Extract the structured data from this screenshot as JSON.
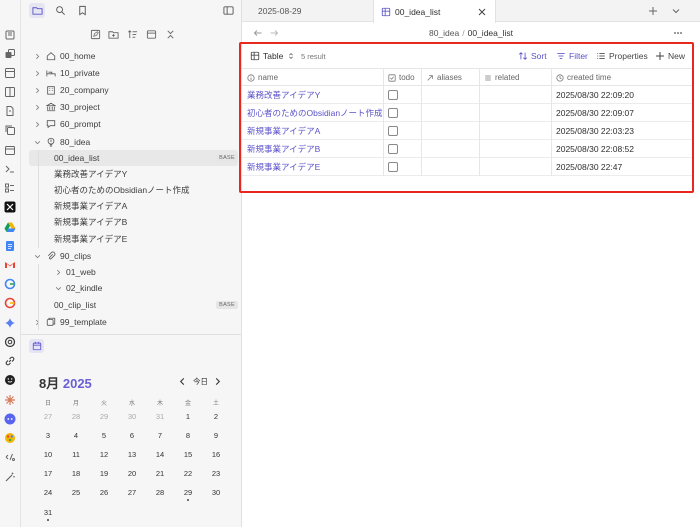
{
  "ribbon": {
    "icons": [
      "files-icon",
      "cards-icon",
      "layout-icon",
      "columns-icon",
      "pages-icon",
      "copy-icon",
      "calendar-icon",
      "terminal-icon",
      "list-icon",
      "x-brand-icon",
      "drive-icon",
      "gdocs-icon",
      "gmail-icon",
      "google-icon",
      "google-alt-icon",
      "gemini-icon",
      "openai-icon",
      "link-icon",
      "smile-icon",
      "claude-icon",
      "discord-icon",
      "palette-icon",
      "percent-icon",
      "wand-icon"
    ]
  },
  "left_tabs": [
    "file-explorer-tab",
    "search-tab",
    "bookmarks-tab"
  ],
  "tree": {
    "items": [
      {
        "label": "00_home",
        "level": 0,
        "expanded": false,
        "icon": "home-icon"
      },
      {
        "label": "10_private",
        "level": 0,
        "expanded": false,
        "icon": "bed-icon"
      },
      {
        "label": "20_company",
        "level": 0,
        "expanded": false,
        "icon": "building-icon"
      },
      {
        "label": "30_project",
        "level": 0,
        "expanded": false,
        "icon": "bank-icon"
      },
      {
        "label": "60_prompt",
        "level": 0,
        "expanded": false,
        "icon": "chat-icon"
      },
      {
        "label": "80_idea",
        "level": 0,
        "expanded": true,
        "icon": "bulb-icon"
      },
      {
        "label": "00_idea_list",
        "level": 1,
        "badge": "BASE",
        "selected": true
      },
      {
        "label": "業務改善アイデアY",
        "level": 1
      },
      {
        "label": "初心者のためのObsidianノート作成",
        "level": 1
      },
      {
        "label": "新規事業アイデアA",
        "level": 1
      },
      {
        "label": "新規事業アイデアB",
        "level": 1
      },
      {
        "label": "新規事業アイデアE",
        "level": 1
      },
      {
        "label": "90_clips",
        "level": 0,
        "expanded": true,
        "icon": "paperclip-icon"
      },
      {
        "label": "01_web",
        "level": 1,
        "expanded": false,
        "folder": true
      },
      {
        "label": "02_kindle",
        "level": 1,
        "expanded": true,
        "folder": true
      },
      {
        "label": "00_clip_list",
        "level": 1,
        "badge": "BASE"
      },
      {
        "label": "99_template",
        "level": 0,
        "expanded": false,
        "icon": "template-icon"
      }
    ]
  },
  "calendar": {
    "month_label": "8月",
    "year_label": "2025",
    "today_label": "今日",
    "weekdays": [
      "日",
      "月",
      "火",
      "水",
      "木",
      "金",
      "土"
    ],
    "weeks": [
      [
        {
          "d": "27",
          "m": true
        },
        {
          "d": "28",
          "m": true
        },
        {
          "d": "29",
          "m": true
        },
        {
          "d": "30",
          "m": true
        },
        {
          "d": "31",
          "m": true
        },
        {
          "d": "1"
        },
        {
          "d": "2"
        }
      ],
      [
        {
          "d": "3"
        },
        {
          "d": "4"
        },
        {
          "d": "5"
        },
        {
          "d": "6"
        },
        {
          "d": "7"
        },
        {
          "d": "8"
        },
        {
          "d": "9"
        }
      ],
      [
        {
          "d": "10"
        },
        {
          "d": "11"
        },
        {
          "d": "12"
        },
        {
          "d": "13"
        },
        {
          "d": "14"
        },
        {
          "d": "15"
        },
        {
          "d": "16"
        }
      ],
      [
        {
          "d": "17"
        },
        {
          "d": "18"
        },
        {
          "d": "19"
        },
        {
          "d": "20"
        },
        {
          "d": "21"
        },
        {
          "d": "22"
        },
        {
          "d": "23"
        }
      ],
      [
        {
          "d": "24"
        },
        {
          "d": "25"
        },
        {
          "d": "26"
        },
        {
          "d": "27"
        },
        {
          "d": "28"
        },
        {
          "d": "29",
          "dot": true
        },
        {
          "d": "30"
        }
      ],
      [
        {
          "d": "31",
          "dot": true
        }
      ]
    ]
  },
  "tabs": {
    "items": [
      {
        "label": "2025-08-29",
        "active": false
      },
      {
        "label": "00_idea_list",
        "active": true
      }
    ]
  },
  "breadcrumb": {
    "parent": "80_idea",
    "separator": "/",
    "current": "00_idea_list"
  },
  "toolbar": {
    "view_label": "Table",
    "result_count": "5 result",
    "sort_label": "Sort",
    "filter_label": "Filter",
    "properties_label": "Properties",
    "new_label": "New"
  },
  "table": {
    "columns": [
      {
        "label": "name",
        "icon": "info-icon"
      },
      {
        "label": "todo",
        "icon": "checkbox-icon"
      },
      {
        "label": "aliases",
        "icon": "arrow-icon"
      },
      {
        "label": "related",
        "icon": "list-icon"
      },
      {
        "label": "created time",
        "icon": "clock-icon"
      }
    ],
    "rows": [
      {
        "name": "業務改善アイデアY",
        "todo": false,
        "aliases": "",
        "related": "",
        "created": "2025/08/30 22:09:20"
      },
      {
        "name": "初心者のためのObsidianノート作成",
        "todo": false,
        "aliases": "",
        "related": "",
        "created": "2025/08/30 22:09:07"
      },
      {
        "name": "新規事業アイデアA",
        "todo": false,
        "aliases": "",
        "related": "",
        "created": "2025/08/30 22:03:23"
      },
      {
        "name": "新規事業アイデアB",
        "todo": false,
        "aliases": "",
        "related": "",
        "created": "2025/08/30 22:08:52"
      },
      {
        "name": "新規事業アイデアE",
        "todo": false,
        "aliases": "",
        "related": "",
        "created": "2025/08/30 22:47"
      }
    ]
  },
  "colors": {
    "accent": "#5a52c9",
    "highlight": "#e8281e"
  }
}
